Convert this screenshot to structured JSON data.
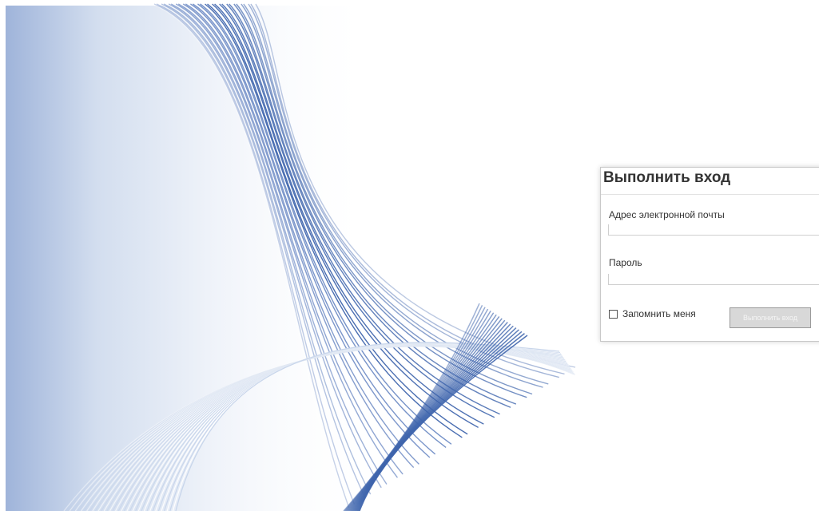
{
  "login": {
    "title": "Выполнить вход",
    "email_label": "Адрес электронной почты",
    "email_value": "",
    "password_label": "Пароль",
    "password_value": "",
    "remember_label": "Запомнить меня",
    "remember_checked": false,
    "submit_label": "Выполнить вход"
  },
  "colors": {
    "wave_dark": "#3f65ad",
    "wave_light": "#c6d4ea",
    "panel_border": "#c8c8c8",
    "button_bg": "#d8d8d8"
  }
}
